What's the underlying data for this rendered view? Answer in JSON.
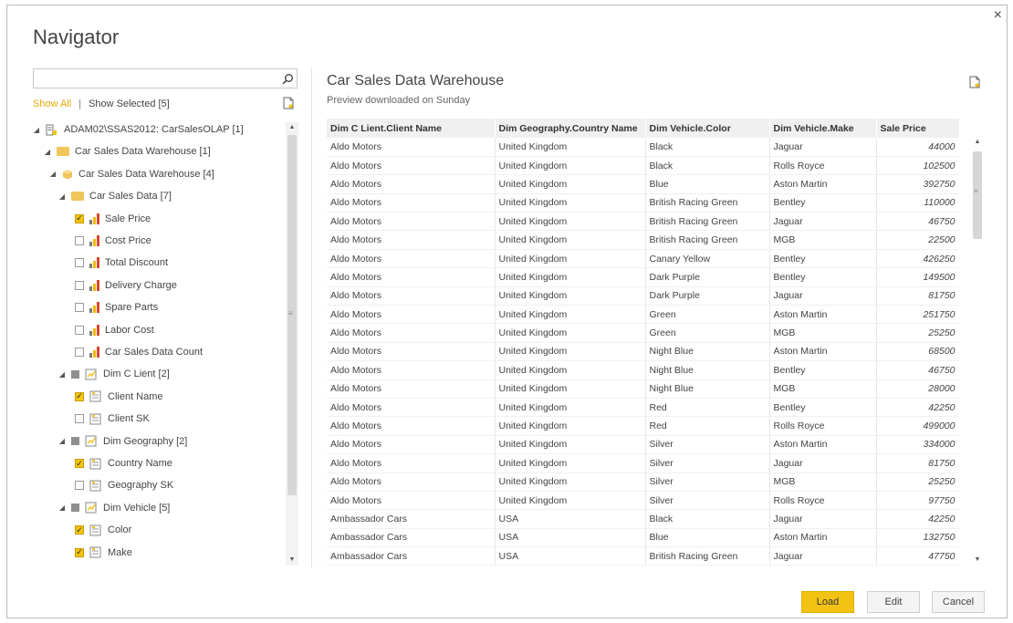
{
  "dialog": {
    "title": "Navigator",
    "close_glyph": "×"
  },
  "left": {
    "search_placeholder": "",
    "show_all": "Show All",
    "separator": "|",
    "show_selected": "Show Selected [5]",
    "tree": [
      {
        "label": "ADAM02\\SSAS2012: CarSalesOLAP [1]",
        "type": "server",
        "level": 0,
        "expanded": true
      },
      {
        "label": "Car Sales Data Warehouse [1]",
        "type": "folder",
        "level": 1,
        "expanded": true
      },
      {
        "label": "Car Sales Data Warehouse [4]",
        "type": "cube",
        "level": 2,
        "expanded": true
      },
      {
        "label": "Car Sales Data [7]",
        "type": "folder",
        "level": 3,
        "expanded": true
      },
      {
        "label": "Sale Price",
        "type": "measure",
        "level": 4,
        "checked": true
      },
      {
        "label": "Cost Price",
        "type": "measure",
        "level": 4,
        "checked": false
      },
      {
        "label": "Total Discount",
        "type": "measure",
        "level": 4,
        "checked": false
      },
      {
        "label": "Delivery Charge",
        "type": "measure",
        "level": 4,
        "checked": false
      },
      {
        "label": "Spare Parts",
        "type": "measure",
        "level": 4,
        "checked": false
      },
      {
        "label": "Labor Cost",
        "type": "measure",
        "level": 4,
        "checked": false
      },
      {
        "label": "Car Sales Data Count",
        "type": "measure",
        "level": 4,
        "checked": false
      },
      {
        "label": "Dim C Lient [2]",
        "type": "dimension",
        "level": 3,
        "expanded": true
      },
      {
        "label": "Client Name",
        "type": "attribute",
        "level": 4,
        "checked": true
      },
      {
        "label": "Client SK",
        "type": "attribute",
        "level": 4,
        "checked": false
      },
      {
        "label": "Dim Geography [2]",
        "type": "dimension",
        "level": 3,
        "expanded": true
      },
      {
        "label": "Country Name",
        "type": "attribute",
        "level": 4,
        "checked": true
      },
      {
        "label": "Geography SK",
        "type": "attribute",
        "level": 4,
        "checked": false
      },
      {
        "label": "Dim Vehicle [5]",
        "type": "dimension",
        "level": 3,
        "expanded": true
      },
      {
        "label": "Color",
        "type": "attribute",
        "level": 4,
        "checked": true
      },
      {
        "label": "Make",
        "type": "attribute",
        "level": 4,
        "checked": true
      }
    ]
  },
  "preview": {
    "title": "Car Sales Data Warehouse",
    "subtitle": "Preview downloaded on Sunday",
    "columns": [
      "Dim C Lient.Client Name",
      "Dim Geography.Country Name",
      "Dim Vehicle.Color",
      "Dim Vehicle.Make",
      "Sale Price"
    ],
    "rows": [
      [
        "Aldo Motors",
        "United Kingdom",
        "Black",
        "Jaguar",
        "44000"
      ],
      [
        "Aldo Motors",
        "United Kingdom",
        "Black",
        "Rolls Royce",
        "102500"
      ],
      [
        "Aldo Motors",
        "United Kingdom",
        "Blue",
        "Aston Martin",
        "392750"
      ],
      [
        "Aldo Motors",
        "United Kingdom",
        "British Racing Green",
        "Bentley",
        "110000"
      ],
      [
        "Aldo Motors",
        "United Kingdom",
        "British Racing Green",
        "Jaguar",
        "46750"
      ],
      [
        "Aldo Motors",
        "United Kingdom",
        "British Racing Green",
        "MGB",
        "22500"
      ],
      [
        "Aldo Motors",
        "United Kingdom",
        "Canary Yellow",
        "Bentley",
        "426250"
      ],
      [
        "Aldo Motors",
        "United Kingdom",
        "Dark Purple",
        "Bentley",
        "149500"
      ],
      [
        "Aldo Motors",
        "United Kingdom",
        "Dark Purple",
        "Jaguar",
        "81750"
      ],
      [
        "Aldo Motors",
        "United Kingdom",
        "Green",
        "Aston Martin",
        "251750"
      ],
      [
        "Aldo Motors",
        "United Kingdom",
        "Green",
        "MGB",
        "25250"
      ],
      [
        "Aldo Motors",
        "United Kingdom",
        "Night Blue",
        "Aston Martin",
        "68500"
      ],
      [
        "Aldo Motors",
        "United Kingdom",
        "Night Blue",
        "Bentley",
        "46750"
      ],
      [
        "Aldo Motors",
        "United Kingdom",
        "Night Blue",
        "MGB",
        "28000"
      ],
      [
        "Aldo Motors",
        "United Kingdom",
        "Red",
        "Bentley",
        "42250"
      ],
      [
        "Aldo Motors",
        "United Kingdom",
        "Red",
        "Rolls Royce",
        "499000"
      ],
      [
        "Aldo Motors",
        "United Kingdom",
        "Silver",
        "Aston Martin",
        "334000"
      ],
      [
        "Aldo Motors",
        "United Kingdom",
        "Silver",
        "Jaguar",
        "81750"
      ],
      [
        "Aldo Motors",
        "United Kingdom",
        "Silver",
        "MGB",
        "25250"
      ],
      [
        "Aldo Motors",
        "United Kingdom",
        "Silver",
        "Rolls Royce",
        "97750"
      ],
      [
        "Ambassador Cars",
        "USA",
        "Black",
        "Jaguar",
        "42250"
      ],
      [
        "Ambassador Cars",
        "USA",
        "Blue",
        "Aston Martin",
        "132750"
      ],
      [
        "Ambassador Cars",
        "USA",
        "British Racing Green",
        "Jaguar",
        "47750"
      ]
    ]
  },
  "buttons": {
    "load": "Load",
    "edit": "Edit",
    "cancel": "Cancel"
  },
  "icons": {
    "search": "search-icon",
    "new_document": "document-icon",
    "measure": "bar-chart-icon",
    "dimension": "dimension-icon"
  },
  "colors": {
    "accent": "#f2c314",
    "folder": "#f0c55a",
    "bar_red": "#d9462b",
    "bar_yellow": "#f2b705",
    "bar_gray": "#7a7a7a"
  }
}
